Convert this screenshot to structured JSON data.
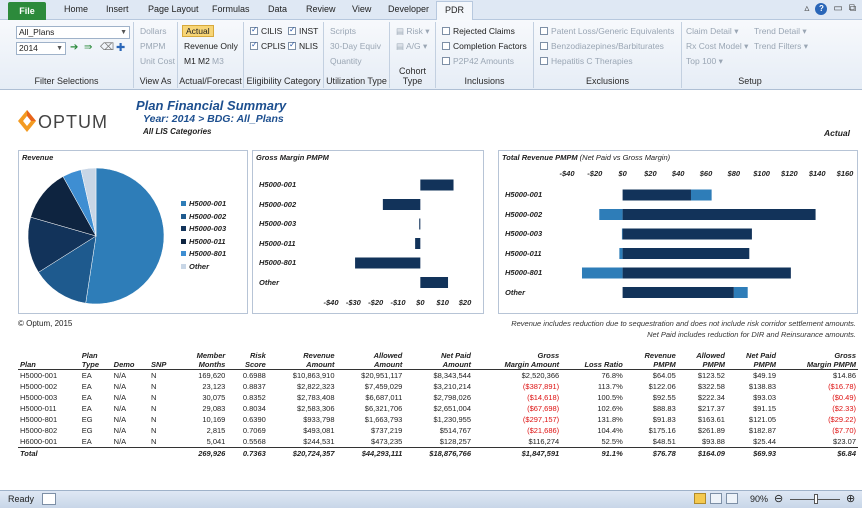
{
  "ribbon_tabs": [
    {
      "label": "File"
    },
    {
      "label": "Home"
    },
    {
      "label": "Insert"
    },
    {
      "label": "Page Layout"
    },
    {
      "label": "Formulas"
    },
    {
      "label": "Data"
    },
    {
      "label": "Review"
    },
    {
      "label": "View"
    },
    {
      "label": "Developer"
    },
    {
      "label": "PDR"
    }
  ],
  "filter": {
    "plans_value": "All_Plans",
    "year_value": "2014",
    "group_label": "Filter Selections"
  },
  "view_as": {
    "dollars": "Dollars",
    "pmpm": "PMPM",
    "unit_cost": "Unit Cost",
    "group_label": "View As"
  },
  "actual_forecast": {
    "actual": "Actual",
    "revenue_only": "Revenue Only",
    "m1": "M1",
    "m2": "M2",
    "m3": "M3",
    "group_label": "Actual/Forecast"
  },
  "eligibility": {
    "cilis": "CILIS",
    "inst": "INST",
    "cplis": "CPLIS",
    "nlis": "NLIS",
    "group_label": "Eligibility Category"
  },
  "utilization": {
    "scripts": "Scripts",
    "day30": "30-Day Equiv",
    "quantity": "Quantity",
    "group_label": "Utilization Type"
  },
  "cohort": {
    "risk": "Risk",
    "ag": "A/G",
    "group_label": "Cohort Type"
  },
  "inclusions": {
    "rejected": "Rejected Claims",
    "completion": "Completion Factors",
    "p2p42": "P2P42 Amounts",
    "group_label": "Inclusions"
  },
  "exclusions": {
    "patent": "Patent Loss/Generic Equivalents",
    "benzo": "Benzodiazepines/Barbiturates",
    "hepc": "Hepatitis C Therapies",
    "group_label": "Exclusions"
  },
  "setup": {
    "claim_detail": "Claim Detail",
    "trend_detail": "Trend Detail",
    "rx_cost_model": "Rx Cost Model",
    "trend_filters": "Trend Filters",
    "top100": "Top 100",
    "group_label": "Setup"
  },
  "report": {
    "logo": "OPTUM",
    "title": "Plan Financial Summary",
    "subtitle": "Year: 2014 > BDG: All_Plans",
    "category": "All LIS Categories",
    "actual": "Actual",
    "copyright": "© Optum, 2015",
    "note1": "Revenue includes reduction due to sequestration and does not include risk corridor settlement amounts.",
    "note2": "Net Paid includes reduction for DIR and Reinsurance amounts."
  },
  "chart_data": [
    {
      "type": "pie",
      "title": "Revenue",
      "categories": [
        "H5000-001",
        "H5000-002",
        "H5000-003",
        "H5000-011",
        "H5000-801",
        "Other"
      ],
      "values": [
        10863910,
        2822323,
        2783408,
        2583306,
        933798,
        737481
      ],
      "colors": [
        "#2e7db8",
        "#1e5a8e",
        "#12335a",
        "#0e2440",
        "#3e8ed2",
        "#c8d6e6"
      ]
    },
    {
      "type": "bar",
      "title": "Gross Margin PMPM",
      "categories": [
        "H5000-001",
        "H5000-002",
        "H5000-003",
        "H5000-011",
        "H5000-801",
        "Other"
      ],
      "values": [
        14.86,
        -16.78,
        -0.49,
        -2.33,
        -29.22,
        12.4
      ],
      "xlim": [
        -40,
        20
      ],
      "xticks": [
        "-$40",
        "-$30",
        "-$20",
        "-$10",
        "$0",
        "$10",
        "$20"
      ]
    },
    {
      "type": "bar",
      "title": "Total Revenue PMPM",
      "subtitle": "(Net Paid vs Gross Margin)",
      "categories": [
        "H5000-001",
        "H5000-002",
        "H5000-003",
        "H5000-011",
        "H5000-801",
        "Other"
      ],
      "series": [
        {
          "values": [
            49.19,
            138.83,
            93.03,
            91.15,
            121.05,
            80
          ]
        },
        {
          "values": [
            14.86,
            -16.78,
            -0.49,
            -2.33,
            -29.22,
            10
          ]
        }
      ],
      "xlim": [
        -40,
        160
      ],
      "xticks": [
        "-$40",
        "-$20",
        "$0",
        "$20",
        "$40",
        "$60",
        "$80",
        "$100",
        "$120",
        "$140",
        "$160"
      ]
    }
  ],
  "table": {
    "headers": [
      [
        "Plan"
      ],
      [
        "Plan",
        "Type"
      ],
      [
        "Demo"
      ],
      [
        "SNP"
      ],
      [
        "Member",
        "Months"
      ],
      [
        "Risk",
        "Score"
      ],
      [
        "Revenue",
        "Amount"
      ],
      [
        "Allowed",
        "Amount"
      ],
      [
        "Net Paid",
        "Amount"
      ],
      [
        "Gross",
        "Margin Amount"
      ],
      [
        "Loss Ratio"
      ],
      [
        "Revenue",
        "PMPM"
      ],
      [
        "Allowed",
        "PMPM"
      ],
      [
        "Net Paid",
        "PMPM"
      ],
      [
        "Gross",
        "Margin PMPM"
      ]
    ],
    "rows": [
      [
        "H5000-001",
        "EA",
        "N/A",
        "N",
        "169,620",
        "0.6988",
        "$10,863,910",
        "$20,951,117",
        "$8,343,544",
        "$2,520,366",
        "76.8%",
        "$64.05",
        "$123.52",
        "$49.19",
        "$14.86"
      ],
      [
        "H5000-002",
        "EA",
        "N/A",
        "N",
        "23,123",
        "0.8837",
        "$2,822,323",
        "$7,459,029",
        "$3,210,214",
        "($387,891)",
        "113.7%",
        "$122.06",
        "$322.58",
        "$138.83",
        "($16.78)"
      ],
      [
        "H5000-003",
        "EA",
        "N/A",
        "N",
        "30,075",
        "0.8352",
        "$2,783,408",
        "$6,687,011",
        "$2,798,026",
        "($14,618)",
        "100.5%",
        "$92.55",
        "$222.34",
        "$93.03",
        "($0.49)"
      ],
      [
        "H5000-011",
        "EA",
        "N/A",
        "N",
        "29,083",
        "0.8034",
        "$2,583,306",
        "$6,321,706",
        "$2,651,004",
        "($67,698)",
        "102.6%",
        "$88.83",
        "$217.37",
        "$91.15",
        "($2.33)"
      ],
      [
        "H5000-801",
        "EG",
        "N/A",
        "N",
        "10,169",
        "0.6390",
        "$933,798",
        "$1,663,793",
        "$1,230,955",
        "($297,157)",
        "131.8%",
        "$91.83",
        "$163.61",
        "$121.05",
        "($29.22)"
      ],
      [
        "H5000-802",
        "EG",
        "N/A",
        "N",
        "2,815",
        "0.7069",
        "$493,081",
        "$737,219",
        "$514,767",
        "($21,686)",
        "104.4%",
        "$175.16",
        "$261.89",
        "$182.87",
        "($7.70)"
      ],
      [
        "H6000-001",
        "EA",
        "N/A",
        "N",
        "5,041",
        "0.5568",
        "$244,531",
        "$473,235",
        "$128,257",
        "$116,274",
        "52.5%",
        "$48.51",
        "$93.88",
        "$25.44",
        "$23.07"
      ]
    ],
    "total": [
      "Total",
      "",
      "",
      "",
      "269,926",
      "0.7363",
      "$20,724,357",
      "$44,293,111",
      "$18,876,766",
      "$1,847,591",
      "91.1%",
      "$76.78",
      "$164.09",
      "$69.93",
      "$6.84"
    ]
  },
  "status": {
    "ready": "Ready",
    "zoom": "90%"
  }
}
